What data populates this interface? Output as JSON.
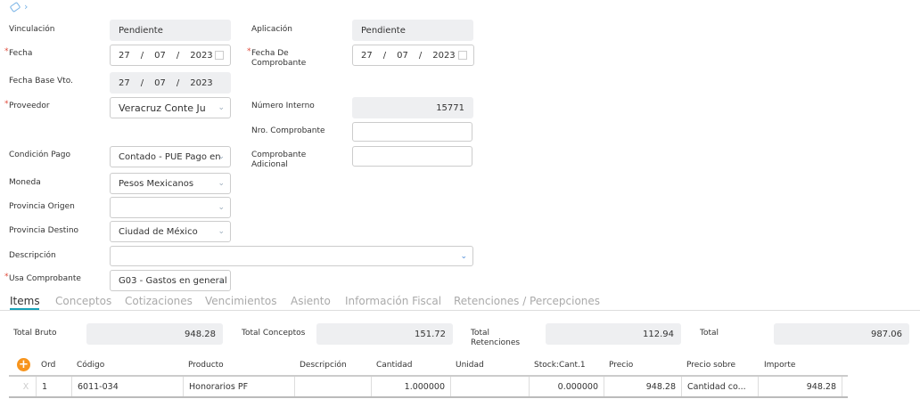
{
  "nav": {
    "tag_icon": "tag-icon",
    "chevron": "›"
  },
  "form": {
    "vinculacion": {
      "label": "Vinculación",
      "value": "Pendiente"
    },
    "aplicacion": {
      "label": "Aplicación",
      "value": "Pendiente"
    },
    "fecha": {
      "label": "Fecha",
      "d": "27",
      "m": "07",
      "y": "2023"
    },
    "fecha_comp": {
      "label1": "Fecha De",
      "label2": "Comprobante",
      "d": "27",
      "m": "07",
      "y": "2023"
    },
    "fecha_base": {
      "label": "Fecha Base Vto.",
      "d": "27",
      "m": "07",
      "y": "2023"
    },
    "proveedor": {
      "label": "Proveedor",
      "value": "Veracruz Conte Ju"
    },
    "numero_interno": {
      "label": "Número Interno",
      "value": "15771"
    },
    "nro_comprobante": {
      "label": "Nro. Comprobante",
      "value": ""
    },
    "condicion_pago": {
      "label": "Condición Pago",
      "value": "Contado - PUE Pago en"
    },
    "comp_adicional": {
      "label1": "Comprobante",
      "label2": "Adicional",
      "value": ""
    },
    "moneda": {
      "label": "Moneda",
      "value": "Pesos Mexicanos"
    },
    "provincia_origen": {
      "label": "Provincia Origen",
      "value": ""
    },
    "provincia_destino": {
      "label": "Provincia Destino",
      "value": "Ciudad de México"
    },
    "descripcion": {
      "label": "Descripción",
      "value": ""
    },
    "usa_comprobante": {
      "label": "Usa Comprobante",
      "value": "G03 - Gastos en general"
    }
  },
  "tabs": [
    "Items",
    "Conceptos",
    "Cotizaciones",
    "Vencimientos",
    "Asiento",
    "Información Fiscal",
    "Retenciones / Percepciones"
  ],
  "totals": {
    "bruto": {
      "label": "Total Bruto",
      "value": "948.28"
    },
    "conceptos": {
      "label": "Total Conceptos",
      "value": "151.72"
    },
    "retenciones": {
      "label1": "Total",
      "label2": "Retenciones",
      "value": "112.94"
    },
    "total": {
      "label": "Total",
      "value": "987.06"
    }
  },
  "table": {
    "add": "+",
    "headers": [
      "Ord",
      "Código",
      "Producto",
      "Descripción",
      "Cantidad",
      "Unidad",
      "Stock:Cant.1",
      "Precio",
      "Precio sobre",
      "Importe"
    ],
    "rows": [
      {
        "del": "X",
        "ord": "1",
        "codigo": "6011-034",
        "producto": "Honorarios PF",
        "descripcion": "",
        "cantidad": "1.000000",
        "unidad": "",
        "stock": "0.000000",
        "precio": "948.28",
        "precio_sobre": "Cantidad co...",
        "importe": "948.28"
      }
    ]
  },
  "colors": {
    "accent": "#17a2b8",
    "required": "#e04a3a",
    "add": "#f7941d"
  }
}
